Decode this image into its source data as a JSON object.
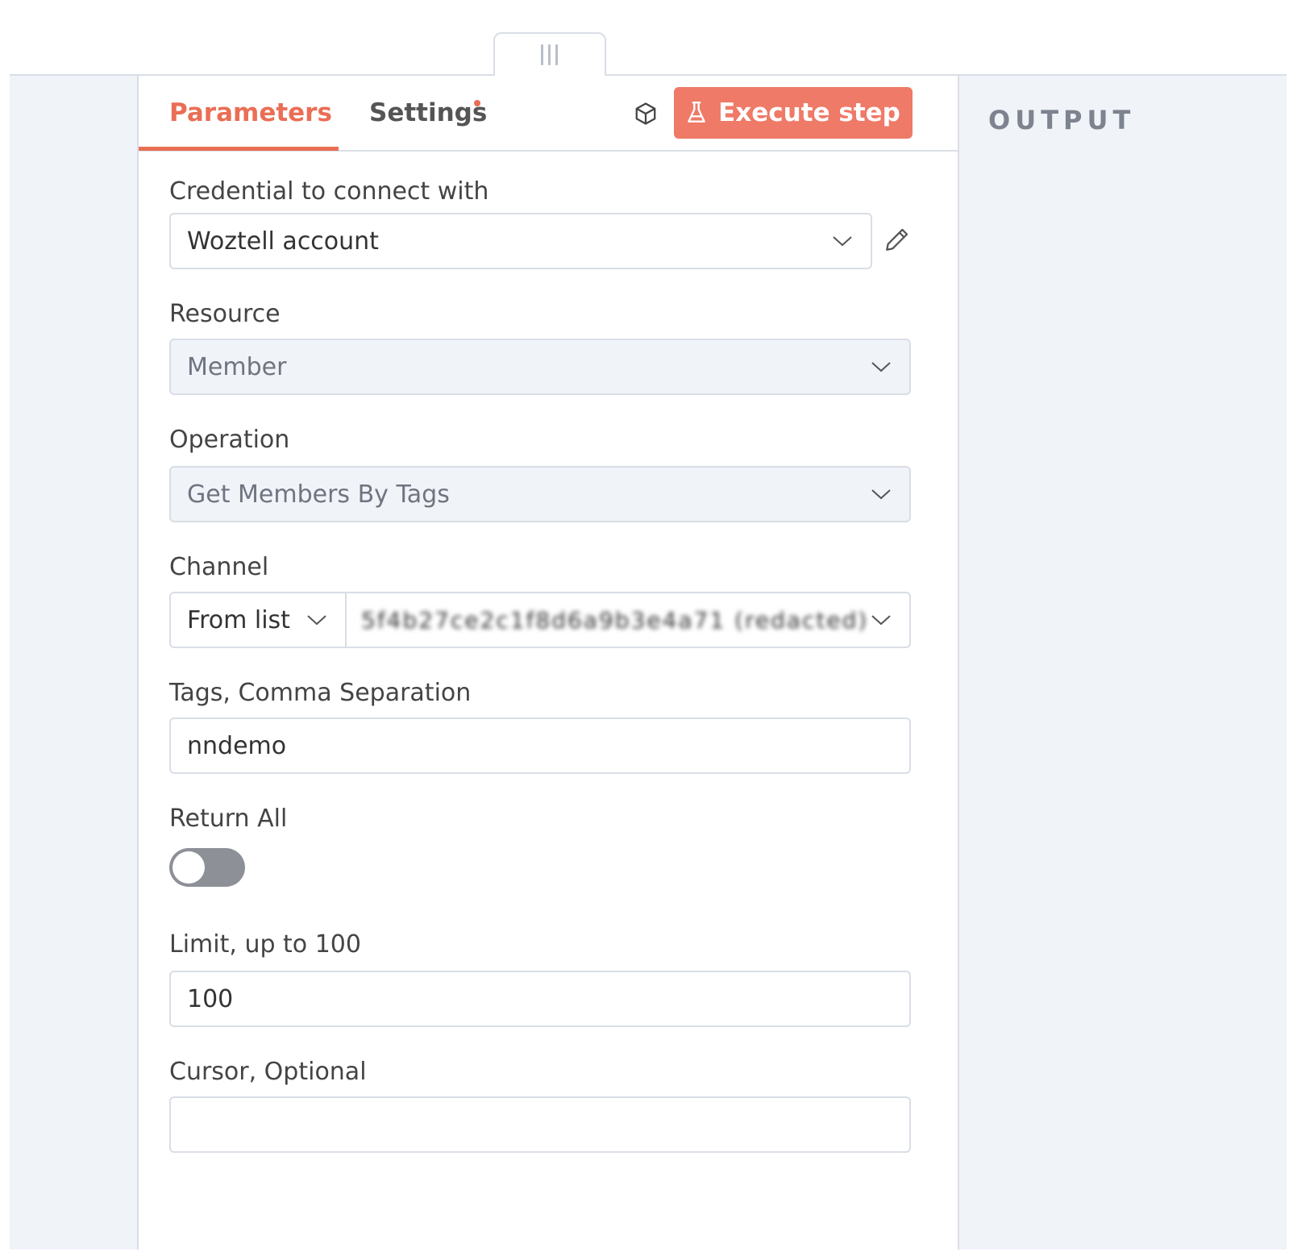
{
  "tabs": {
    "parameters": "Parameters",
    "settings": "Settings"
  },
  "execute_button": "Execute step",
  "output": {
    "title": "OUTPUT"
  },
  "fields": {
    "credential": {
      "label": "Credential to connect with",
      "value": "Woztell account"
    },
    "resource": {
      "label": "Resource",
      "value": "Member"
    },
    "operation": {
      "label": "Operation",
      "value": "Get Members By Tags"
    },
    "channel": {
      "label": "Channel",
      "mode": "From list",
      "value": "5f4b27ce2c1f8d6a9b3e4a71 (redacted)"
    },
    "tags": {
      "label": "Tags, Comma Separation",
      "value": "nndemo"
    },
    "return_all": {
      "label": "Return All",
      "enabled": false
    },
    "limit": {
      "label": "Limit, up to 100",
      "value": "100"
    },
    "cursor": {
      "label": "Cursor, Optional",
      "value": ""
    }
  },
  "colors": {
    "accent": "#ea6e55",
    "button": "#ee7a67",
    "panel_bg": "#f0f3f8",
    "border": "#d9dee6"
  },
  "icons": {
    "drag": "drag-handle-icon",
    "cube": "cube-icon",
    "flask": "flask-icon",
    "chevron": "chevron-down-icon",
    "pencil": "pencil-icon"
  }
}
